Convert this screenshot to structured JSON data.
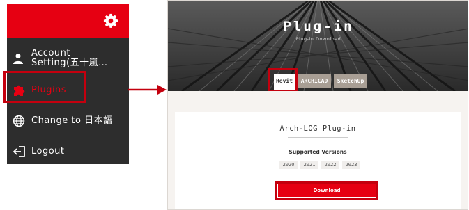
{
  "menu": {
    "items": [
      {
        "label": "Account\nSetting(五十嵐…",
        "icon": "user-icon"
      },
      {
        "label": "Plugins",
        "icon": "puzzle-icon"
      },
      {
        "label": "Change to 日本語",
        "icon": "globe-icon"
      },
      {
        "label": "Logout",
        "icon": "logout-icon"
      }
    ],
    "header_icon": "gear-icon",
    "colors": {
      "accent": "#e60012",
      "background": "#2d2d2d"
    }
  },
  "page": {
    "title": "Plug-in",
    "subtitle": "Plug-in Download",
    "tabs": [
      "Revit",
      "ARCHICAD",
      "SketchUp"
    ],
    "active_tab": "Revit",
    "card": {
      "title": "Arch-LOG Plug-in",
      "supported_label": "Supported Versions",
      "versions": [
        "2020",
        "2021",
        "2022",
        "2023"
      ],
      "download_label": "Download"
    }
  }
}
